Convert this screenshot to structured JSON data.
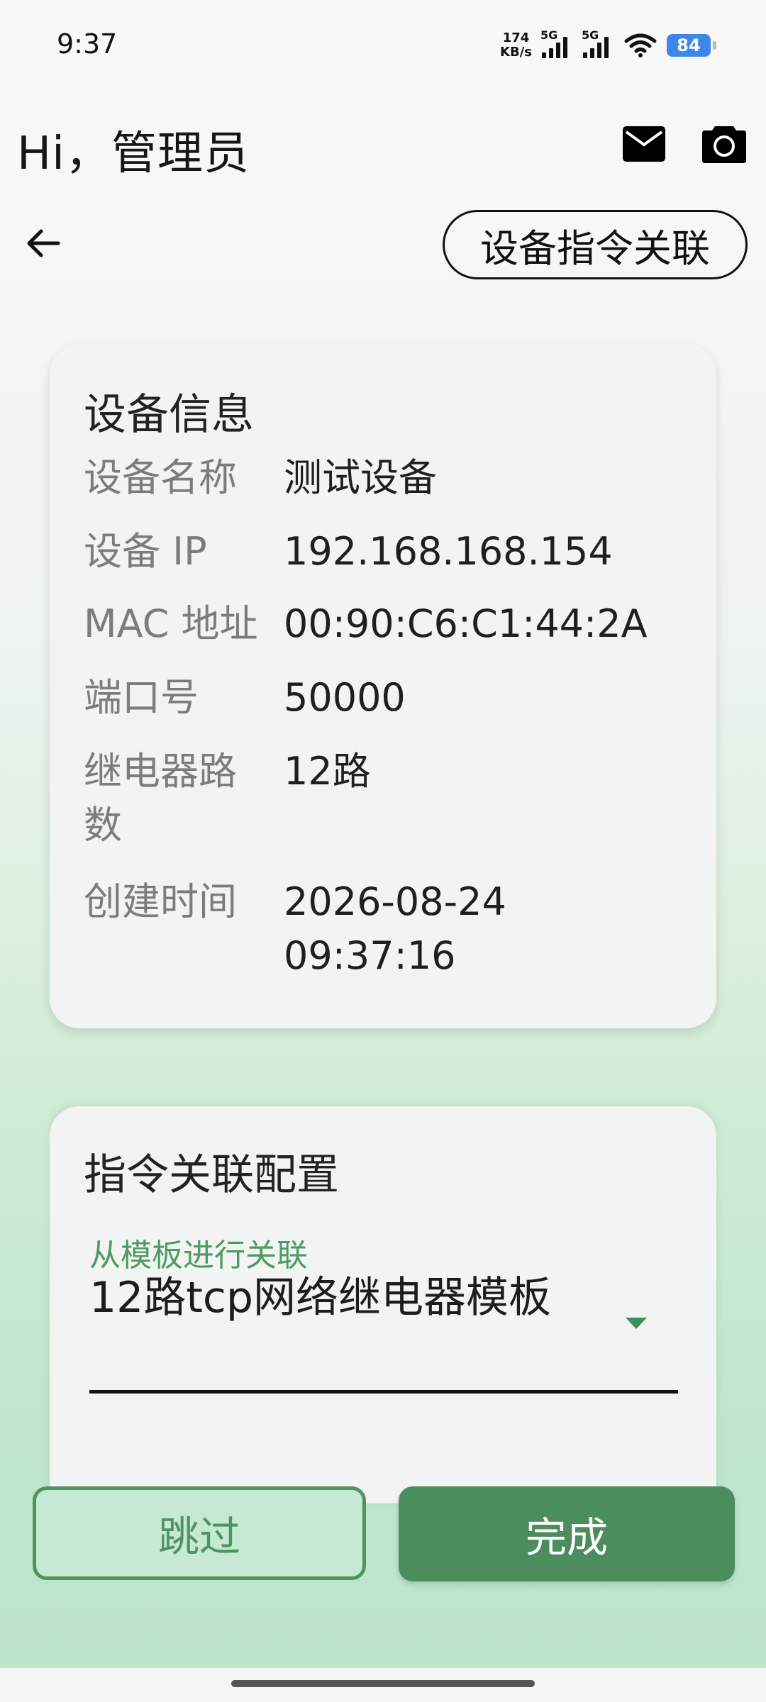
{
  "status_bar": {
    "time": "9:37",
    "net_speed_value": "174",
    "net_speed_unit": "KB/s",
    "sim1": "5G",
    "sim2": "5G",
    "battery": "84"
  },
  "header": {
    "greeting": "Hi，管理员",
    "mail_icon": "mail-icon",
    "camera_icon": "camera-icon"
  },
  "toolbar": {
    "back_icon": "arrow-left-icon",
    "page_title": "设备指令关联"
  },
  "device_info": {
    "title": "设备信息",
    "rows": [
      {
        "label": "设备名称",
        "value": "测试设备"
      },
      {
        "label": "设备 IP",
        "value": "192.168.168.154"
      },
      {
        "label": "MAC 地址",
        "value": "00:90:C6:C1:44:2A"
      },
      {
        "label": "端口号",
        "value": "50000"
      },
      {
        "label": "继电器路数",
        "value": "12路"
      },
      {
        "label": "创建时间",
        "value": "2026-08-24 09:37:16"
      }
    ]
  },
  "command_config": {
    "title": "指令关联配置",
    "dropdown_label": "从模板进行关联",
    "dropdown_value": "12路tcp网络继电器模板"
  },
  "actions": {
    "skip": "跳过",
    "done": "完成"
  },
  "colors": {
    "accent": "#4b8d5c",
    "label_green": "#4e9a63",
    "battery_blue": "#3d87e8"
  }
}
